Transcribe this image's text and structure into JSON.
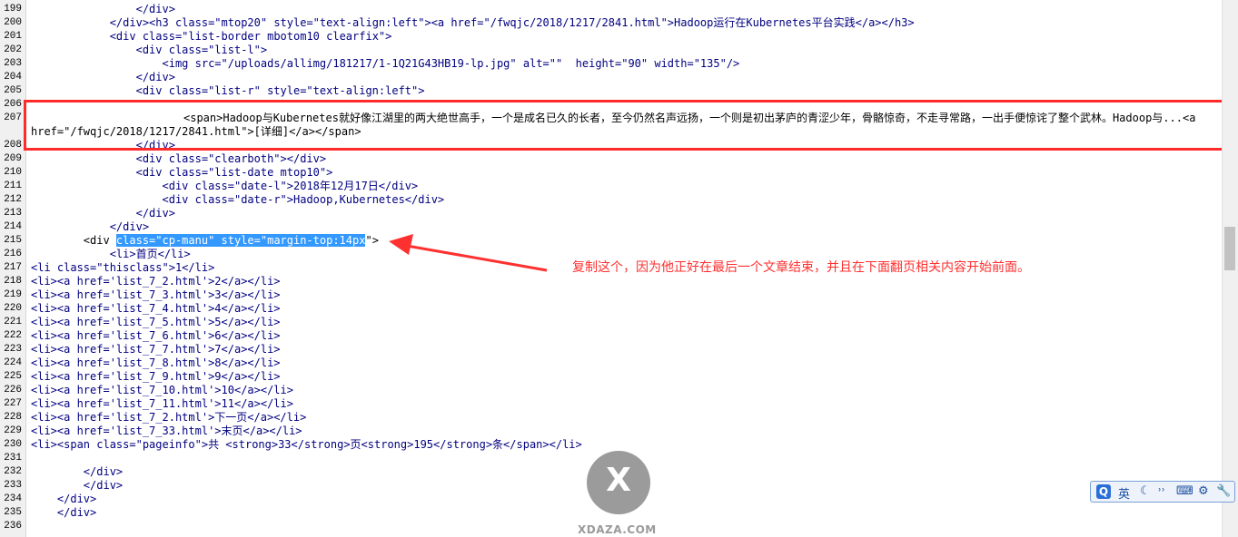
{
  "lines": [
    {
      "no": "199",
      "indent": "                ",
      "html": "</div>"
    },
    {
      "no": "200",
      "indent": "            ",
      "html": "</div><h3 class=\"mtop20\" style=\"text-align:left\"><a href=\"/fwqjc/2018/1217/2841.html\">Hadoop运行在Kubernetes平台实践</a></h3>"
    },
    {
      "no": "201",
      "indent": "            ",
      "html": "<div class=\"list-border mbotom10 clearfix\">"
    },
    {
      "no": "202",
      "indent": "                ",
      "html": "<div class=\"list-l\">"
    },
    {
      "no": "203",
      "indent": "                    ",
      "html": "<img src=\"/uploads/allimg/181217/1-1Q21G43HB19-lp.jpg\" alt=\"\"  height=\"90\" width=\"135\"/>"
    },
    {
      "no": "204",
      "indent": "                ",
      "html": "</div>"
    },
    {
      "no": "205",
      "indent": "                ",
      "html": "<div class=\"list-r\" style=\"text-align:left\">"
    },
    {
      "no": "206",
      "indent": "",
      "html": ""
    },
    {
      "no": "207",
      "indent": "                    ",
      "html": "<span>Hadoop与Kubernetes就好像江湖里的两大绝世高手，一个是成名已久的长者，至今仍然名声远扬，一个则是初出茅庐的青涩少年，骨骼惊奇，不走寻常路，一出手便惊诧了整个武林。Hadoop与...<a href=\"/fwqjc/2018/1217/2841.html\">[详细]</a></span>"
    },
    {
      "no": "208",
      "indent": "                ",
      "html": "</div>"
    },
    {
      "no": "209",
      "indent": "                ",
      "html": "<div class=\"clearboth\"></div>"
    },
    {
      "no": "210",
      "indent": "                ",
      "html": "<div class=\"list-date mtop10\">"
    },
    {
      "no": "211",
      "indent": "                    ",
      "html": "<div class=\"date-l\">2018年12月17日</div>"
    },
    {
      "no": "212",
      "indent": "                    ",
      "html": "<div class=\"date-r\">Hadoop,Kubernetes</div>"
    },
    {
      "no": "213",
      "indent": "                ",
      "html": "</div>"
    },
    {
      "no": "214",
      "indent": "            ",
      "html": "</div>"
    },
    {
      "no": "215",
      "indent": "        ",
      "pre": "<div ",
      "selected": "class=\"cp-manu\" style=\"margin-top:14px",
      "post": "\">"
    },
    {
      "no": "216",
      "indent": "            ",
      "html": "<li>首页</li>"
    },
    {
      "no": "217",
      "indent": "",
      "html": "<li class=\"thisclass\">1</li>"
    },
    {
      "no": "218",
      "indent": "",
      "html": "<li><a href='list_7_2.html'>2</a></li>"
    },
    {
      "no": "219",
      "indent": "",
      "html": "<li><a href='list_7_3.html'>3</a></li>"
    },
    {
      "no": "220",
      "indent": "",
      "html": "<li><a href='list_7_4.html'>4</a></li>"
    },
    {
      "no": "221",
      "indent": "",
      "html": "<li><a href='list_7_5.html'>5</a></li>"
    },
    {
      "no": "222",
      "indent": "",
      "html": "<li><a href='list_7_6.html'>6</a></li>"
    },
    {
      "no": "223",
      "indent": "",
      "html": "<li><a href='list_7_7.html'>7</a></li>"
    },
    {
      "no": "224",
      "indent": "",
      "html": "<li><a href='list_7_8.html'>8</a></li>"
    },
    {
      "no": "225",
      "indent": "",
      "html": "<li><a href='list_7_9.html'>9</a></li>"
    },
    {
      "no": "226",
      "indent": "",
      "html": "<li><a href='list_7_10.html'>10</a></li>"
    },
    {
      "no": "227",
      "indent": "",
      "html": "<li><a href='list_7_11.html'>11</a></li>"
    },
    {
      "no": "228",
      "indent": "",
      "html": "<li><a href='list_7_2.html'>下一页</a></li>"
    },
    {
      "no": "229",
      "indent": "",
      "html": "<li><a href='list_7_33.html'>末页</a></li>"
    },
    {
      "no": "230",
      "indent": "",
      "html": "<li><span class=\"pageinfo\">共 <strong>33</strong>页<strong>195</strong>条</span></li>"
    },
    {
      "no": "231",
      "indent": "",
      "html": ""
    },
    {
      "no": "232",
      "indent": "        ",
      "html": "</div>"
    },
    {
      "no": "233",
      "indent": "        ",
      "html": "</div>"
    },
    {
      "no": "234",
      "indent": "    ",
      "html": "</div>"
    },
    {
      "no": "235",
      "indent": "    ",
      "html": "</div>"
    },
    {
      "no": "236",
      "indent": "",
      "html": ""
    }
  ],
  "annotation": {
    "note": "复制这个，因为他正好在最后一个文章结束，并且在下面翻页相关内容开始前面。",
    "color": "#ff3030"
  },
  "ime": {
    "logo": "Q",
    "lang": "英",
    "icons": [
      "moon-icon",
      "punctuation-icon",
      "keyboard-icon",
      "tools-icon",
      "wrench-icon"
    ]
  },
  "watermark": {
    "letter": "X",
    "text": "XDAZA.COM"
  }
}
